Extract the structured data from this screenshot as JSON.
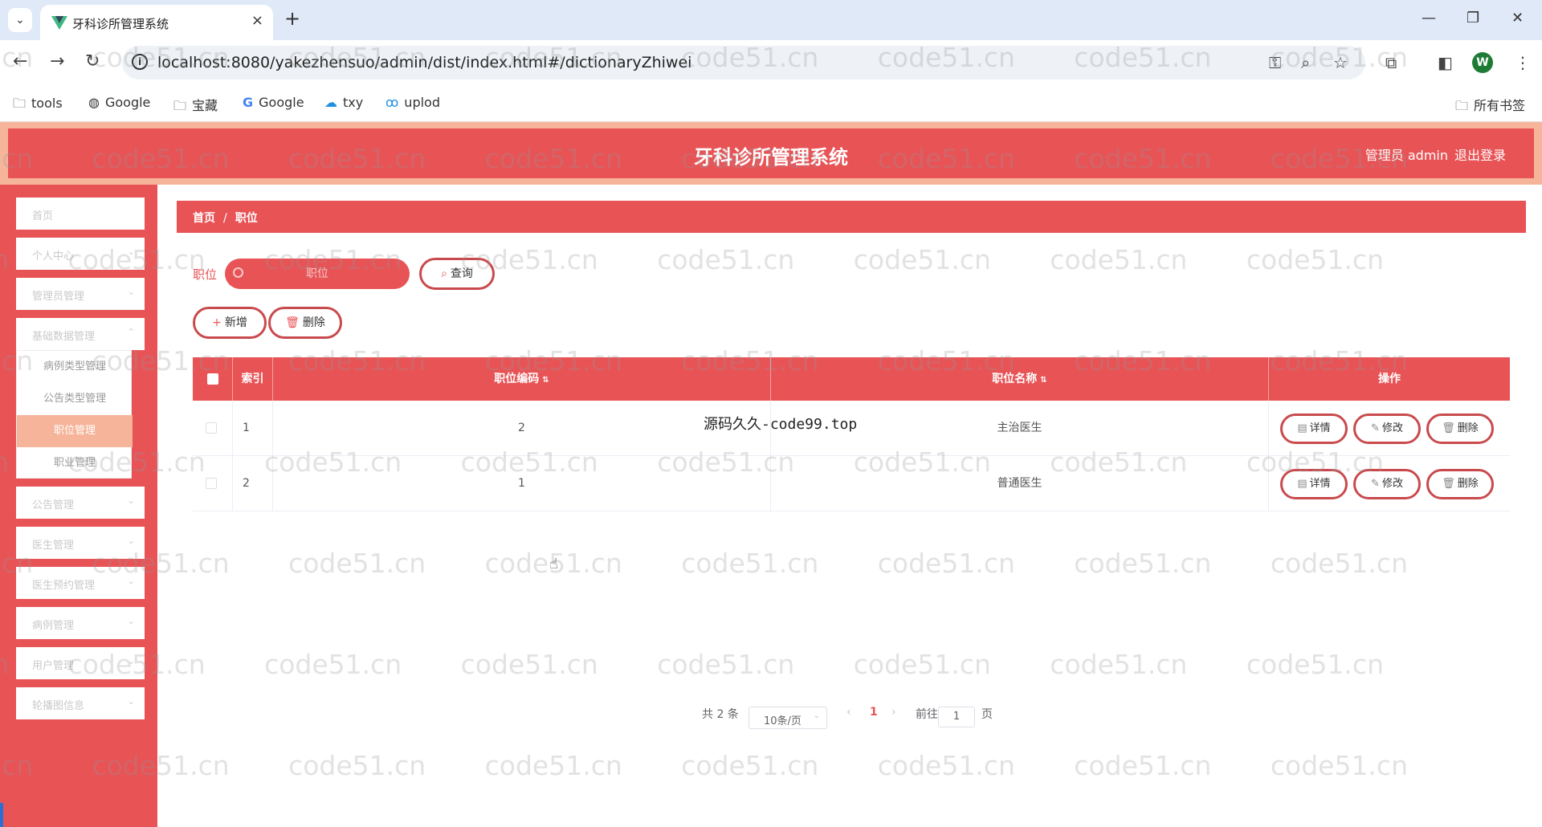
{
  "browser": {
    "tab_title": "牙科诊所管理系统",
    "url": "localhost:8080/yakezhensuo/admin/dist/index.html#/dictionaryZhiwei",
    "profile_initial": "W",
    "bookmarks": [
      "tools",
      "Google",
      "宝藏",
      "Google",
      "txy",
      "uplod"
    ],
    "all_bookmarks": "所有书签"
  },
  "app": {
    "title": "牙科诊所管理系统",
    "user": "管理员 admin",
    "logout": "退出登录"
  },
  "sidebar": {
    "items": [
      "首页",
      "个人中心",
      "管理员管理",
      "基础数据管理",
      "公告管理",
      "医生管理",
      "医生预约管理",
      "病例管理",
      "用户管理",
      "轮播图信息"
    ],
    "submenu": [
      "病例类型管理",
      "公告类型管理",
      "职位管理",
      "职业管理"
    ]
  },
  "breadcrumb": {
    "home": "首页",
    "sep": "/",
    "current": "职位"
  },
  "search": {
    "label": "职位",
    "placeholder": "职位",
    "button": "查询"
  },
  "actions": {
    "add": "新增",
    "delete": "删除"
  },
  "table": {
    "headers": {
      "index": "索引",
      "code": "职位编码",
      "name": "职位名称",
      "ops": "操作"
    },
    "rows": [
      {
        "index": "1",
        "code": "2",
        "name": "主治医生"
      },
      {
        "index": "2",
        "code": "1",
        "name": "普通医生"
      }
    ],
    "row_buttons": {
      "detail": "详情",
      "edit": "修改",
      "delete": "删除"
    }
  },
  "overlay": "源码久久-code99.top",
  "pagination": {
    "total": "共 2 条",
    "page_size": "10条/页",
    "current_page": "1",
    "goto_prefix": "前往",
    "goto_value": "1",
    "goto_suffix": "页"
  },
  "watermark": "code51.cn",
  "colors": {
    "primary": "#e85356",
    "header_border": "#f6b59a",
    "active_sub": "#f6b59a"
  }
}
